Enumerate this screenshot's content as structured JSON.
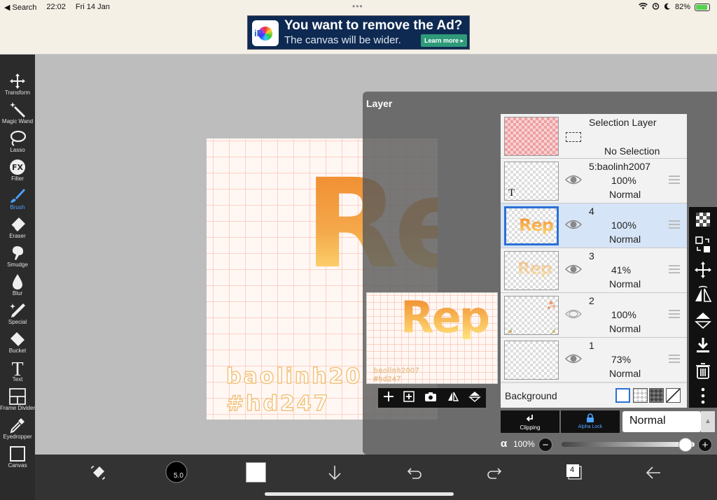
{
  "status_bar": {
    "back_label": "◀ Search",
    "time": "22:02",
    "date": "Fri 14 Jan",
    "battery": "82%",
    "multitask_dots": "•••"
  },
  "ad": {
    "logo_text": "iP",
    "title": "You want to remove the Ad?",
    "subtitle": "The canvas will be wider.",
    "button": "Learn more ▸"
  },
  "toolbar": {
    "items": [
      {
        "label": "Transform",
        "icon": "move-arrows-icon"
      },
      {
        "label": "Magic Wand",
        "icon": "magic-wand-icon"
      },
      {
        "label": "Lasso",
        "icon": "lasso-icon"
      },
      {
        "label": "Filter",
        "icon": "fx-icon"
      },
      {
        "label": "Brush",
        "icon": "brush-icon",
        "active": true
      },
      {
        "label": "Eraser",
        "icon": "eraser-icon"
      },
      {
        "label": "Smudge",
        "icon": "smudge-icon"
      },
      {
        "label": "Blur",
        "icon": "drop-icon"
      },
      {
        "label": "Special",
        "icon": "special-pen-icon"
      },
      {
        "label": "Bucket",
        "icon": "bucket-icon"
      },
      {
        "label": "Text",
        "icon": "text-t-icon"
      },
      {
        "label": "Frame Divider",
        "icon": "frame-divider-icon"
      },
      {
        "label": "Eyedropper",
        "icon": "eyedropper-icon"
      },
      {
        "label": "Canvas",
        "icon": "canvas-icon"
      }
    ],
    "fx_glyph": "FX",
    "text_glyph": "T"
  },
  "artwork": {
    "word": "Rep",
    "line1": "baolinh20",
    "line2": "#hd247"
  },
  "layer_panel": {
    "title": "Layer",
    "preview_word": "Rep",
    "preview_line1": "baolinh2007",
    "preview_line2": "#hd247",
    "selection_layer": {
      "title": "Selection Layer",
      "subtitle": "No Selection"
    },
    "layers": [
      {
        "name": "5:baolinh2007",
        "opacity": "100%",
        "blend": "Normal",
        "thumb_text": "T"
      },
      {
        "name": "4",
        "opacity": "100%",
        "blend": "Normal",
        "selected": true,
        "thumb_text": "Rep"
      },
      {
        "name": "3",
        "opacity": "41%",
        "blend": "Normal",
        "thumb_text": "Rep"
      },
      {
        "name": "2",
        "opacity": "100%",
        "blend": "Normal"
      },
      {
        "name": "1",
        "opacity": "73%",
        "blend": "Normal"
      }
    ],
    "background_label": "Background",
    "clipping_label": "Clipping",
    "alpha_lock_label": "Alpha Lock",
    "blend_mode": "Normal",
    "alpha_symbol": "α",
    "alpha_value": "100%",
    "minus": "−",
    "plus": "+"
  },
  "bottom_bar": {
    "brush_size": "5.0",
    "layer_count": "4"
  },
  "colors": {
    "accent": "#2a6fd6",
    "active_tool": "#4da3ff",
    "toolbar_bg": "#2b2b2b",
    "canvas_bg": "#bdbdbd"
  }
}
